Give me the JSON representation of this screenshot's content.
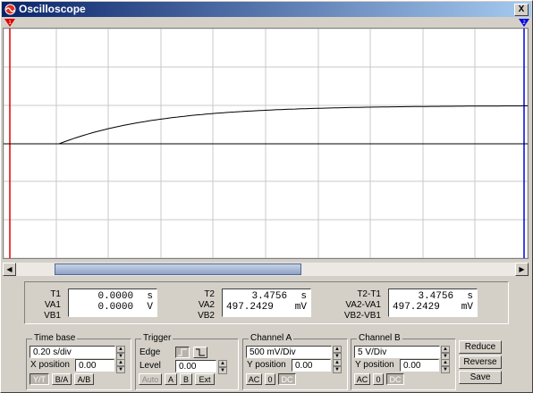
{
  "window": {
    "title": "Oscilloscope",
    "close_label": "X"
  },
  "cursors": {
    "a_label": "1",
    "b_label": "2",
    "a_color": "#e00000",
    "b_color": "#0000e0"
  },
  "screen": {
    "trace_color": "#000000",
    "grid_color": "#c8c8c8",
    "background": "#ffffff"
  },
  "readout": {
    "t1": {
      "labels": [
        "T1",
        "VA1",
        "VB1"
      ],
      "values": [
        "0.0000",
        "0.0000"
      ],
      "units": [
        "s",
        "V"
      ]
    },
    "t2": {
      "labels": [
        "T2",
        "VA2",
        "VB2"
      ],
      "values": [
        "3.4756",
        "497.2429"
      ],
      "units": [
        "s",
        "mV"
      ]
    },
    "diff": {
      "labels": [
        "T2-T1",
        "VA2-VA1",
        "VB2-VB1"
      ],
      "values": [
        "3.4756",
        "497.2429"
      ],
      "units": [
        "s",
        "mV"
      ]
    }
  },
  "timebase": {
    "title": "Time base",
    "scale": "0.20 s/div",
    "xpos_label": "X position",
    "xpos": "0.00",
    "modes": [
      "Y/T",
      "B/A",
      "A/B"
    ]
  },
  "trigger": {
    "title": "Trigger",
    "edge_label": "Edge",
    "level_label": "Level",
    "level": "0.00",
    "modes": [
      "Auto",
      "A",
      "B",
      "Ext"
    ]
  },
  "channel_a": {
    "title": "Channel A",
    "scale": "500 mV/Div",
    "ypos_label": "Y position",
    "ypos": "0.00",
    "coupling": [
      "AC",
      "0",
      "DC"
    ]
  },
  "channel_b": {
    "title": "Channel B",
    "scale": "5 V/Div",
    "ypos_label": "Y position",
    "ypos": "0.00",
    "coupling": [
      "AC",
      "0",
      "DC"
    ]
  },
  "actions": {
    "reduce": "Reduce",
    "reverse": "Reverse",
    "save": "Save"
  }
}
